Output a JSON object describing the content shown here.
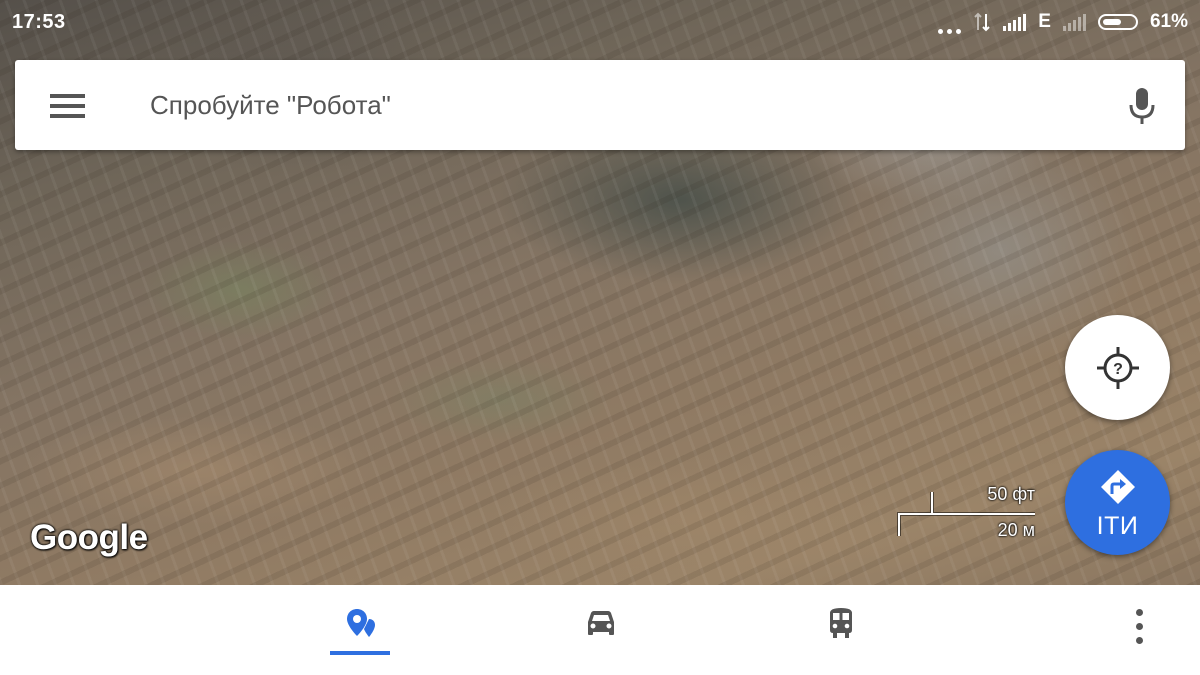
{
  "status_bar": {
    "time": "17:53",
    "network_type": "E",
    "battery_percent_label": "61%",
    "battery_level": 0.61
  },
  "search": {
    "placeholder": "Спробуйте \"Робота\"",
    "menu_icon": "hamburger-menu-icon",
    "mic_icon": "microphone-icon"
  },
  "map": {
    "type": "satellite",
    "logo": "Google",
    "scale_top_label": "50 фт",
    "scale_bottom_label": "20 м"
  },
  "fabs": {
    "location_icon": "my-location-unknown-icon",
    "directions_label": "ІТИ",
    "directions_icon": "directions-icon",
    "directions_color": "#2e6fe0"
  },
  "bottom_nav": {
    "tabs": [
      {
        "id": "explore",
        "icon": "explore-pin-icon",
        "active": true
      },
      {
        "id": "driving",
        "icon": "car-icon",
        "active": false
      },
      {
        "id": "transit",
        "icon": "train-icon",
        "active": false
      }
    ],
    "overflow_icon": "more-vert-icon",
    "active_color": "#2e6fe0",
    "inactive_color": "#555555"
  }
}
